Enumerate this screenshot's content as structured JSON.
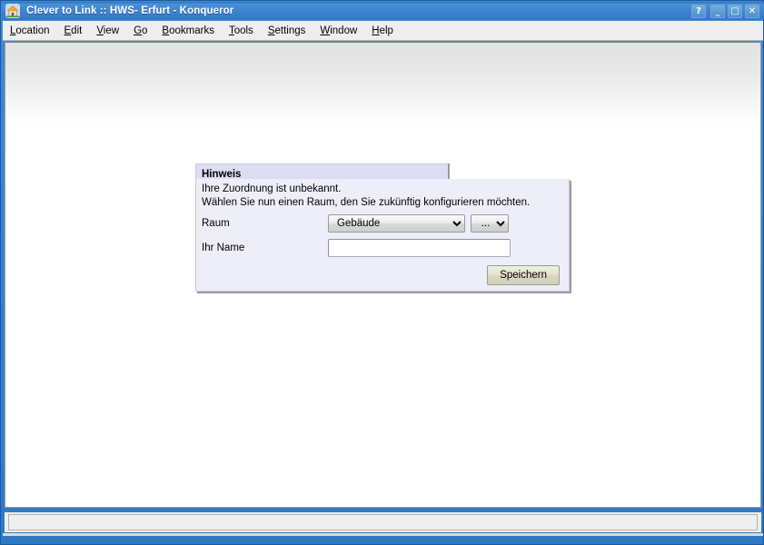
{
  "window": {
    "title": "Clever to Link :: HWS- Erfurt - Konqueror",
    "app_icon": "home-icon",
    "controls": [
      {
        "name": "help-button",
        "glyph": "?"
      },
      {
        "name": "minimize-button",
        "glyph": "_"
      },
      {
        "name": "maximize-button",
        "glyph": "□"
      },
      {
        "name": "close-button",
        "glyph": "✕"
      }
    ],
    "titlebar_color": "#3c82cf"
  },
  "menubar": {
    "items": [
      {
        "pre": "",
        "acc": "L",
        "post": "ocation"
      },
      {
        "pre": "",
        "acc": "E",
        "post": "dit"
      },
      {
        "pre": "",
        "acc": "V",
        "post": "iew"
      },
      {
        "pre": "",
        "acc": "G",
        "post": "o"
      },
      {
        "pre": "",
        "acc": "B",
        "post": "ookmarks"
      },
      {
        "pre": "",
        "acc": "T",
        "post": "ools"
      },
      {
        "pre": "",
        "acc": "S",
        "post": "ettings"
      },
      {
        "pre": "",
        "acc": "W",
        "post": "indow"
      },
      {
        "pre": "",
        "acc": "H",
        "post": "elp"
      }
    ]
  },
  "dialog": {
    "header_title": "Hinweis",
    "message_line1": "Ihre Zuordnung ist unbekannt.",
    "message_line2": "Wählen Sie nun einen Raum, den Sie zukünftig konfigurieren möchten.",
    "fields": [
      {
        "label": "Raum",
        "type": "select",
        "name": "room-select",
        "value": "Gebäude",
        "options": [
          "Gebäude"
        ]
      },
      {
        "label": "",
        "type": "select",
        "name": "room-detail-select",
        "value": "...",
        "options": [
          "..."
        ]
      },
      {
        "label": "Ihr Name",
        "type": "text",
        "name": "your-name-input",
        "value": "",
        "placeholder": ""
      }
    ],
    "save_label": "Speichern",
    "header_bg": "#dcdcf2",
    "body_bg": "#eeeef8"
  },
  "statusbar": {
    "text": ""
  }
}
